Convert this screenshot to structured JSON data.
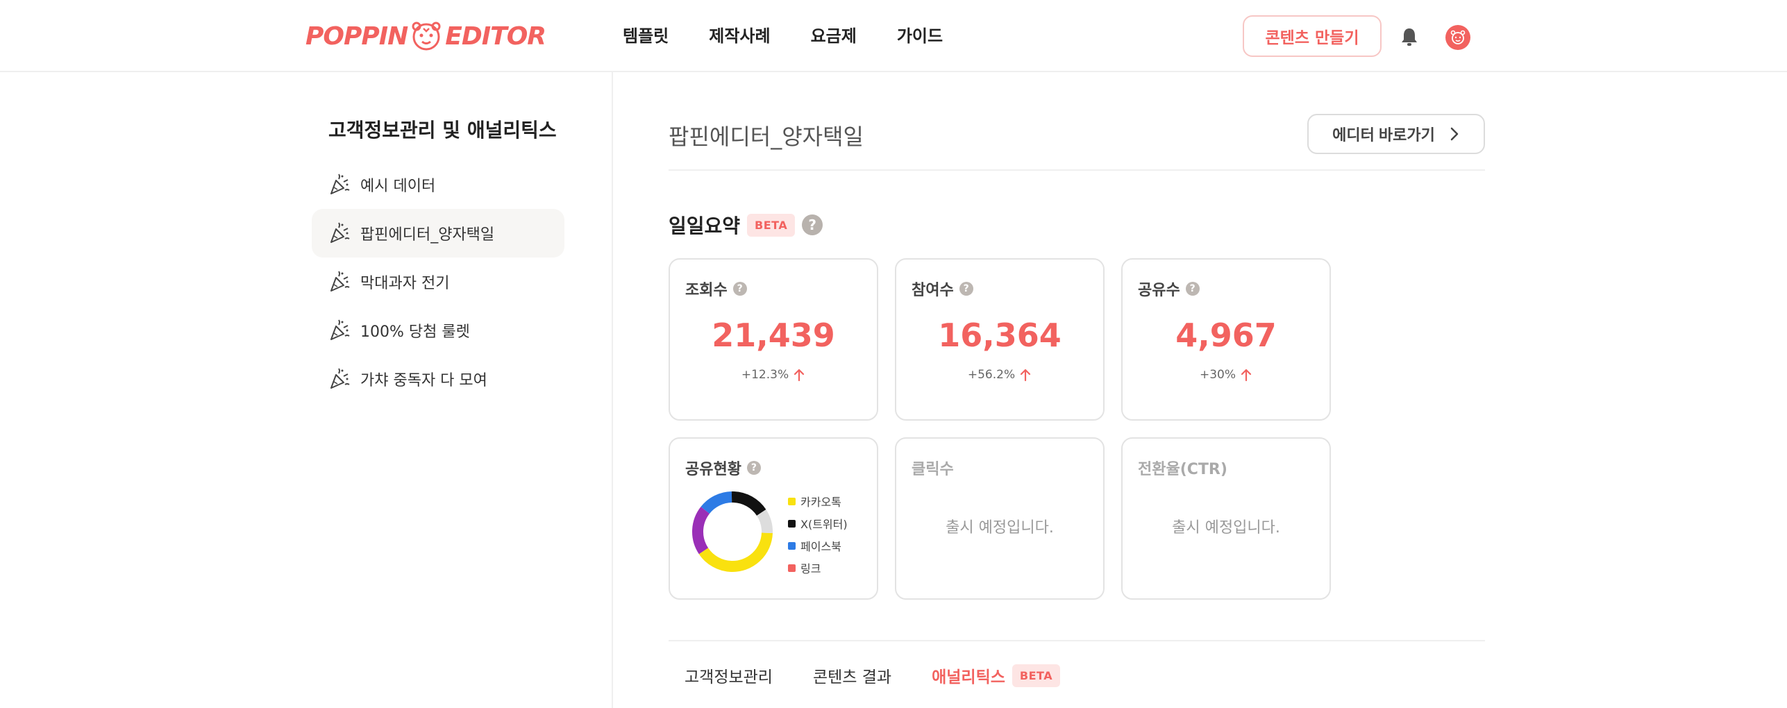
{
  "header": {
    "logo_left": "POPPIN",
    "logo_right": "EDITOR",
    "nav": [
      "템플릿",
      "제작사례",
      "요금제",
      "가이드"
    ],
    "create_button": "콘텐츠 만들기",
    "icons": [
      "bell-icon",
      "avatar-icon"
    ]
  },
  "sidebar": {
    "title": "고객정보관리 및 애널리틱스",
    "items": [
      {
        "label": "예시 데이터",
        "active": false
      },
      {
        "label": "팝핀에디터_양자택일",
        "active": true
      },
      {
        "label": "막대과자 전기",
        "active": false
      },
      {
        "label": "100% 당첨 룰렛",
        "active": false
      },
      {
        "label": "가챠 중독자 다 모여",
        "active": false
      }
    ]
  },
  "main": {
    "title": "팝핀에디터_양자택일",
    "editor_button": "에디터 바로가기",
    "summary": {
      "title": "일일요약",
      "badge": "BETA",
      "help": "?"
    },
    "cards": {
      "views": {
        "label": "조회수",
        "value": "21,439",
        "delta": "+12.3%"
      },
      "participants": {
        "label": "참여수",
        "value": "16,364",
        "delta": "+56.2%"
      },
      "shares": {
        "label": "공유수",
        "value": "4,967",
        "delta": "+30%"
      },
      "share_status": {
        "label": "공유현황"
      },
      "clicks": {
        "label": "클릭수",
        "note": "출시 예정입니다."
      },
      "ctr": {
        "label": "전환율(CTR)",
        "note": "출시 예정입니다."
      }
    },
    "share_breakdown": {
      "legend": [
        {
          "name": "카카오톡",
          "color": "#f9e10f"
        },
        {
          "name": "X(트위터)",
          "color": "#111111"
        },
        {
          "name": "페이스북",
          "color": "#2d7be5"
        },
        {
          "name": "링크",
          "color": "#f2625f"
        }
      ],
      "segments": [
        {
          "name": "카카오톡",
          "color": "#f9e10f",
          "fraction": 0.4
        },
        {
          "name": "purple",
          "color": "#9a2fb7",
          "fraction": 0.2
        },
        {
          "name": "페이스북",
          "color": "#2d7be5",
          "fraction": 0.14
        },
        {
          "name": "X(트위터)",
          "color": "#111111",
          "fraction": 0.16
        },
        {
          "name": "gray",
          "color": "#dddddd",
          "fraction": 0.1
        }
      ]
    },
    "tabs": [
      {
        "label": "고객정보관리",
        "active": false
      },
      {
        "label": "콘텐츠 결과",
        "active": false
      },
      {
        "label": "애널리틱스",
        "active": true,
        "badge": "BETA"
      }
    ]
  },
  "colors": {
    "accent": "#f2625f",
    "badge_bg": "#fde5e4",
    "border": "#e3e3e3"
  }
}
